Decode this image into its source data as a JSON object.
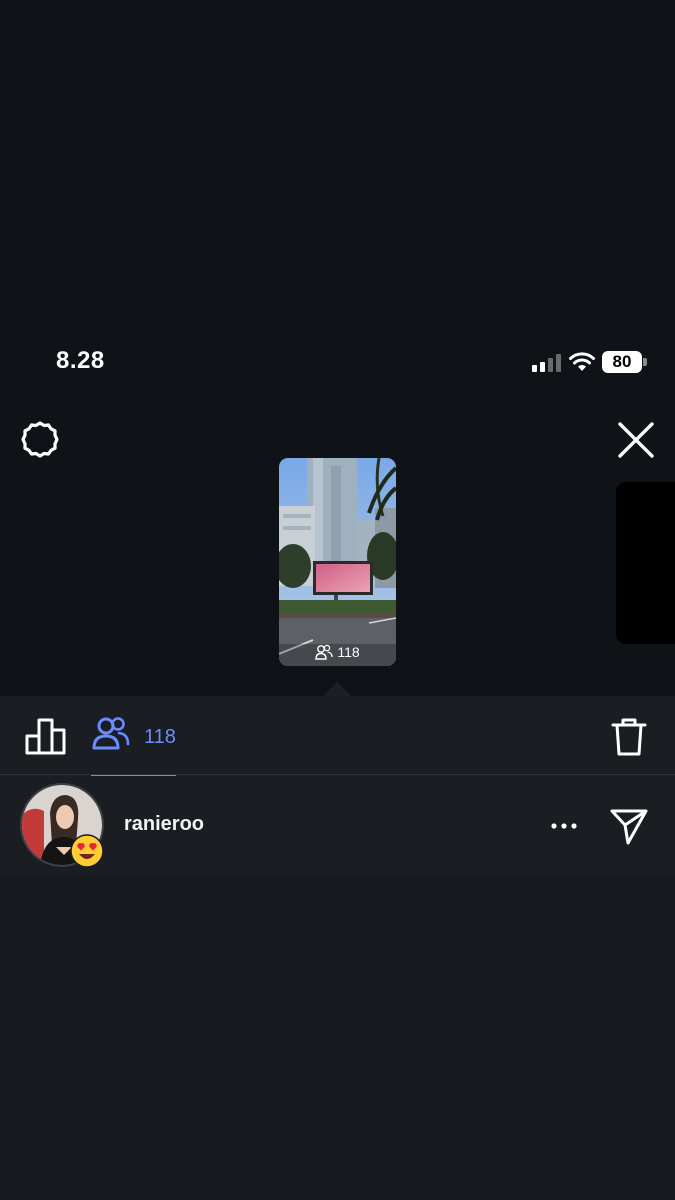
{
  "status_bar": {
    "time": "8.28",
    "battery": "80"
  },
  "header": {
    "settings_icon": "gear-icon",
    "close_icon": "close-icon"
  },
  "story": {
    "viewer_count": "118",
    "viewer_icon": "users-icon"
  },
  "tabs": {
    "insights_icon": "bar-chart-icon",
    "viewers_icon": "users-icon",
    "viewers_count": "118",
    "delete_icon": "trash-icon"
  },
  "viewers": [
    {
      "username": "ranieroo",
      "reaction": "heart-eyes-emoji",
      "more_icon": "more-icon",
      "send_icon": "send-icon"
    }
  ],
  "colors": {
    "background": "#0f1216",
    "panel": "#1a1d21",
    "accent": "#6b8cff",
    "text": "#ffffff"
  }
}
